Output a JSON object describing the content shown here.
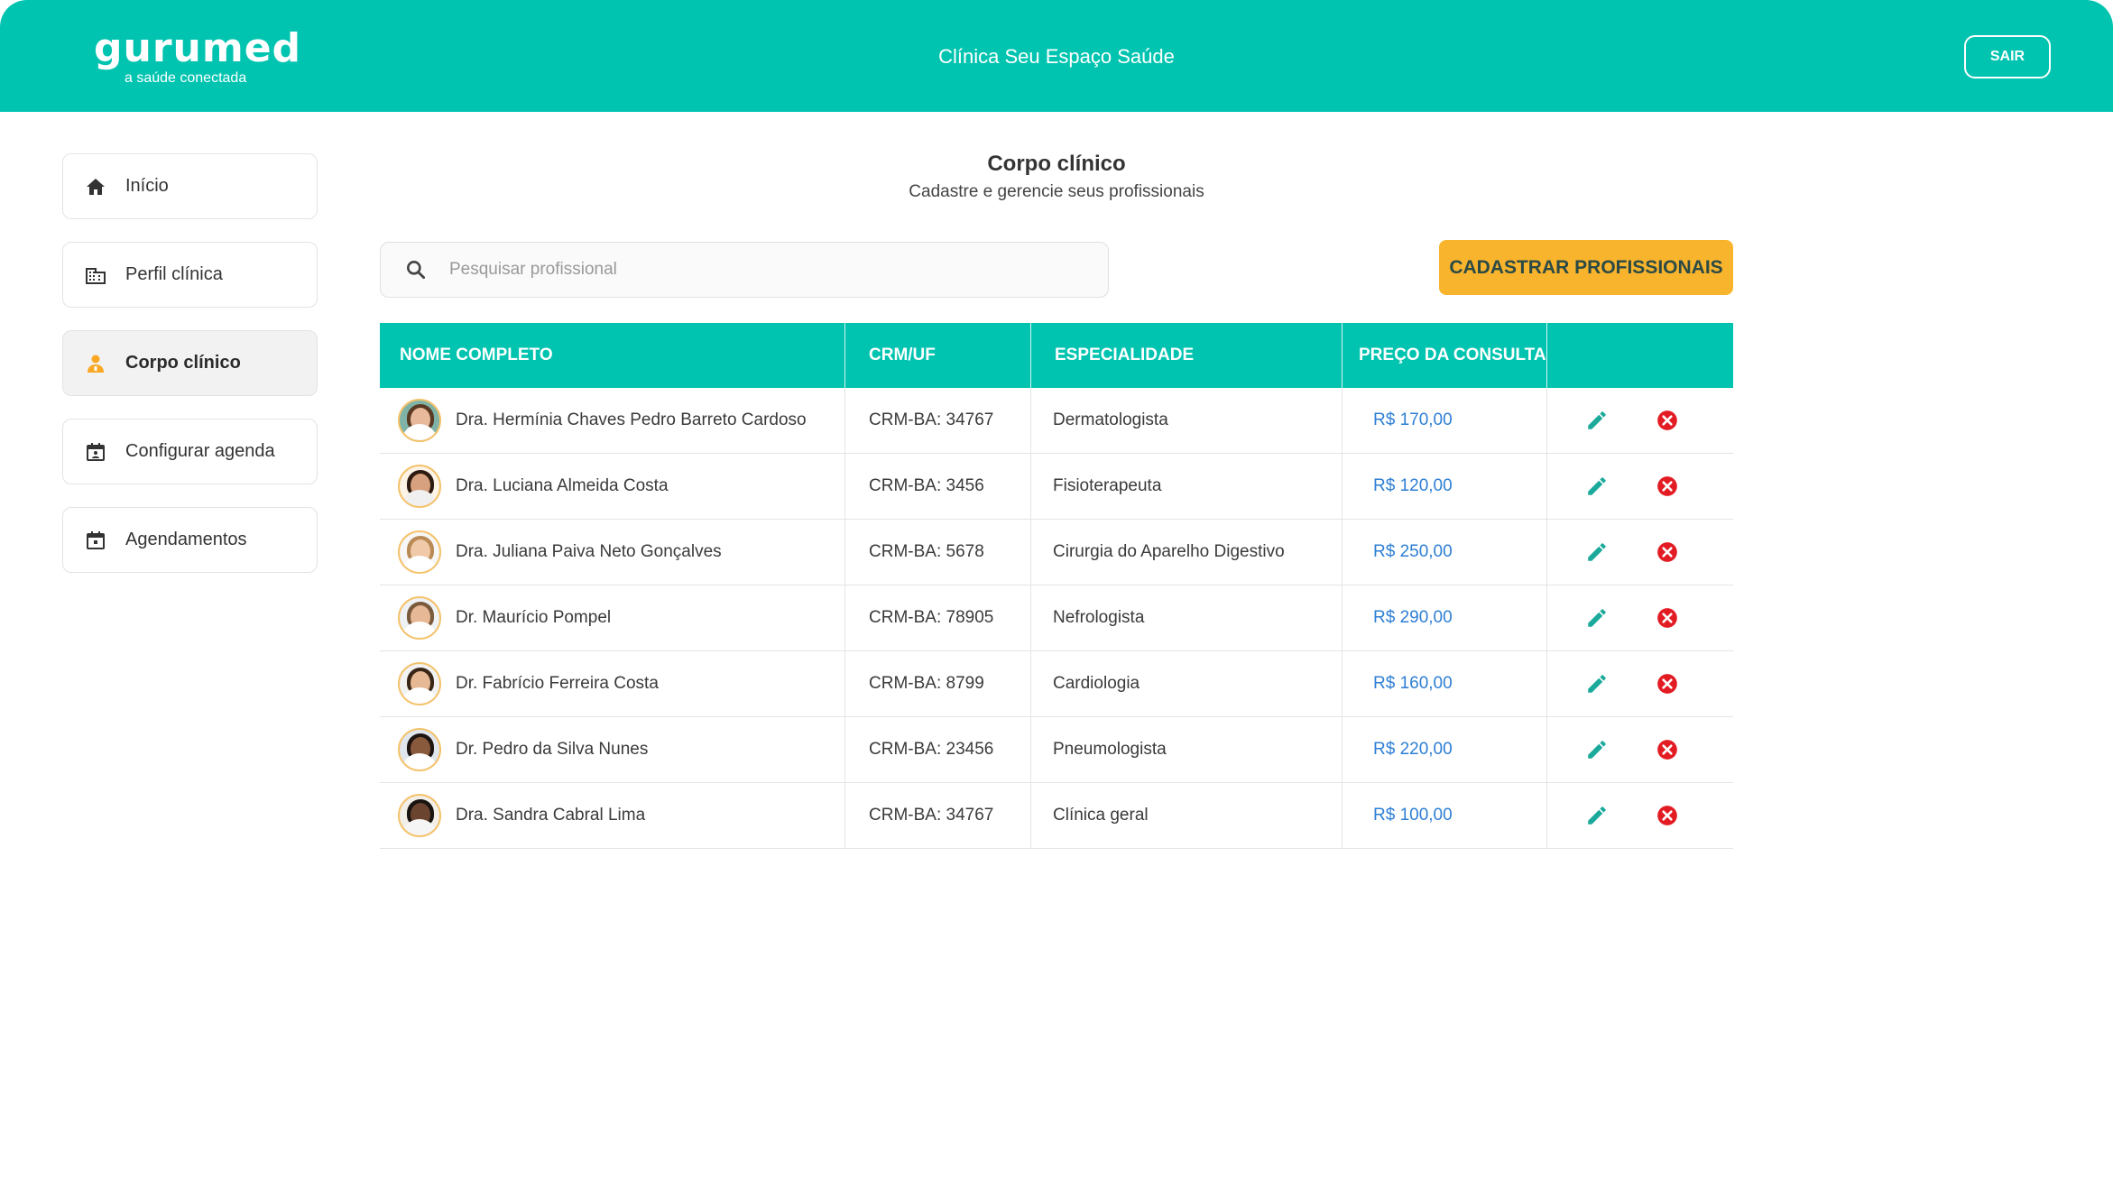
{
  "header": {
    "logo": "gurumed",
    "tagline": "a saúde conectada",
    "clinic_name": "Clínica Seu Espaço Saúde",
    "logout_label": "SAIR"
  },
  "sidebar": {
    "items": [
      {
        "label": "Início",
        "icon": "home-icon"
      },
      {
        "label": "Perfil clínica",
        "icon": "building-icon"
      },
      {
        "label": "Corpo clínico",
        "icon": "doctor-icon",
        "active": true
      },
      {
        "label": "Configurar agenda",
        "icon": "calendar-person-icon"
      },
      {
        "label": "Agendamentos",
        "icon": "calendar-icon"
      }
    ]
  },
  "main": {
    "title": "Corpo clínico",
    "subtitle": "Cadastre e gerencie seus profissionais",
    "search_placeholder": "Pesquisar profissional",
    "add_button_label": "CADASTRAR PROFISSIONAIS"
  },
  "table": {
    "columns": [
      "NOME COMPLETO",
      "CRM/UF",
      "ESPECIALIDADE",
      "PREÇO DA CONSULTA",
      ""
    ],
    "rows": [
      {
        "name": "Dra. Hermínia Chaves Pedro Barreto Cardoso",
        "crm": "CRM-BA: 34767",
        "specialty": "Dermatologista",
        "price": "R$ 170,00"
      },
      {
        "name": "Dra. Luciana Almeida Costa",
        "crm": "CRM-BA: 3456",
        "specialty": "Fisioterapeuta",
        "price": "R$ 120,00"
      },
      {
        "name": "Dra. Juliana Paiva Neto Gonçalves",
        "crm": "CRM-BA: 5678",
        "specialty": "Cirurgia do Aparelho Digestivo",
        "price": "R$ 250,00"
      },
      {
        "name": "Dr. Maurício Pompel",
        "crm": "CRM-BA: 78905",
        "specialty": "Nefrologista",
        "price": "R$ 290,00"
      },
      {
        "name": "Dr. Fabrício Ferreira Costa",
        "crm": "CRM-BA: 8799",
        "specialty": "Cardiologia",
        "price": "R$ 160,00"
      },
      {
        "name": "Dr. Pedro da Silva Nunes",
        "crm": "CRM-BA: 23456",
        "specialty": "Pneumologista",
        "price": "R$ 220,00"
      },
      {
        "name": "Dra. Sandra Cabral Lima",
        "crm": "CRM-BA: 34767",
        "specialty": "Clínica geral",
        "price": "R$ 100,00"
      }
    ]
  },
  "colors": {
    "primary": "#00c4b0",
    "accent": "#f9b42d",
    "price": "#2e7fd4",
    "delete": "#e31b23",
    "edit": "#1aa99a"
  }
}
